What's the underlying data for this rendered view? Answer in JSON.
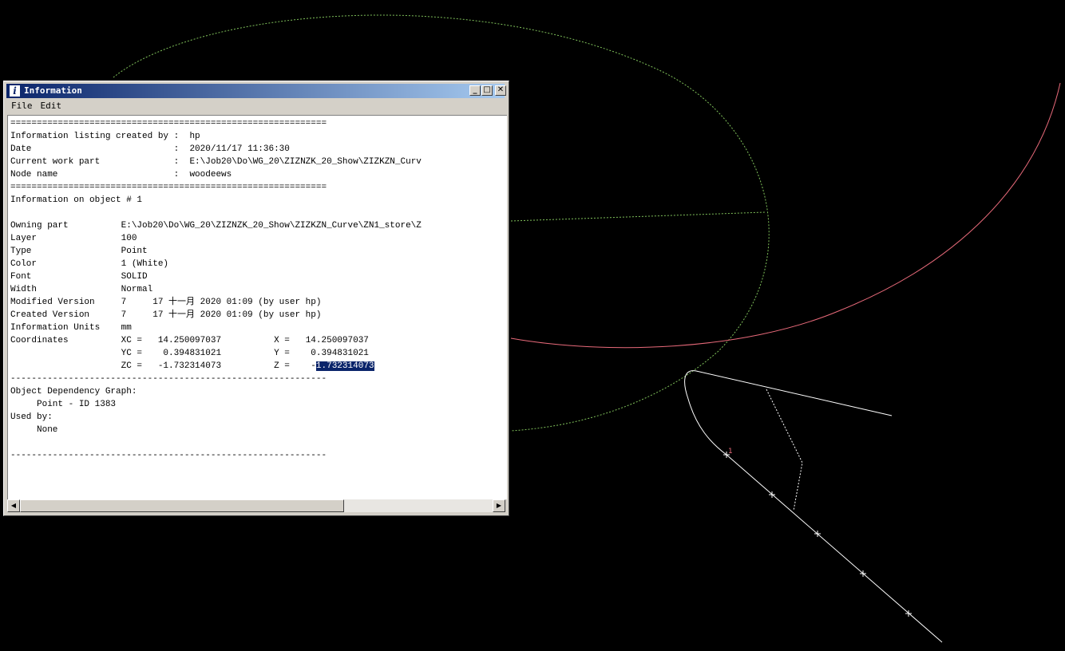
{
  "window": {
    "title": "Information",
    "icon_glyph": "i",
    "menu": [
      "File",
      "Edit"
    ],
    "controls": {
      "minimize": "_",
      "maximize": "□",
      "close": "✕"
    }
  },
  "listing": {
    "separator_double": "============================================================",
    "header": [
      {
        "label": "Information listing created by",
        "sep": " :  ",
        "value": "hp"
      },
      {
        "label": "Date                          ",
        "sep": " :  ",
        "value": "2020/11/17 11:36:30"
      },
      {
        "label": "Current work part             ",
        "sep": " :  ",
        "value": "E:\\Job20\\Do\\WG_20\\ZIZNZK_20_Show\\ZIZKZN_Curv"
      },
      {
        "label": "Node name                     ",
        "sep": " :  ",
        "value": "woodeews"
      }
    ],
    "object_title": "Information on object # 1",
    "props": [
      {
        "label": "Owning part",
        "value": "E:\\Job20\\Do\\WG_20\\ZIZNZK_20_Show\\ZIZKZN_Curve\\ZN1_store\\Z"
      },
      {
        "label": "Layer",
        "value": "100"
      },
      {
        "label": "Type",
        "value": "Point"
      },
      {
        "label": "Color",
        "value": "1 (White)"
      },
      {
        "label": "Font",
        "value": "SOLID"
      },
      {
        "label": "Width",
        "value": "Normal"
      },
      {
        "label": "Modified Version",
        "value": "7     17 十一月 2020 01:09 (by user hp)"
      },
      {
        "label": "Created Version",
        "value": "7     17 十一月 2020 01:09 (by user hp)"
      },
      {
        "label": "Information Units",
        "value": "mm"
      }
    ],
    "coordinates_label": "Coordinates",
    "coordinates": [
      {
        "wlabel": "XC =",
        "wval": "14.250097037",
        "alabel": "X =",
        "aval": "14.250097037"
      },
      {
        "wlabel": "YC =",
        "wval": "0.394831021",
        "alabel": "Y =",
        "aval": "0.394831021"
      },
      {
        "wlabel": "ZC =",
        "wval": "-1.732314073",
        "alabel": "Z =",
        "aval_prefix": "-",
        "aval_selected": "1.732314073"
      }
    ],
    "separator_single": "------------------------------------------------------------",
    "dependency_title": "Object Dependency Graph:",
    "dependency_item": "     Point - ID 1383",
    "used_by_title": "Used by:",
    "used_by_item": "     None"
  },
  "viewport": {
    "point_label": "1",
    "colors": {
      "ellipse": "#7fc05a",
      "arc": "#e86a7a",
      "curve": "#ffffff"
    }
  }
}
